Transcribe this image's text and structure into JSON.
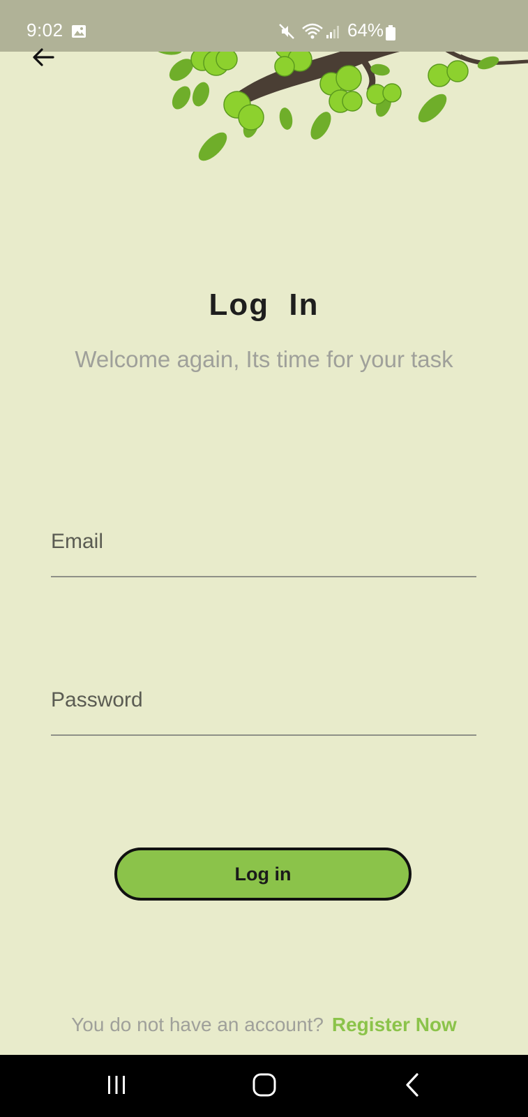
{
  "status_bar": {
    "time": "9:02",
    "battery": "64%",
    "icons": [
      "image-icon",
      "mute-icon",
      "wifi-icon",
      "signal-icon",
      "battery-icon"
    ]
  },
  "header": {
    "back_icon": "back-arrow-icon"
  },
  "main": {
    "title": "Log  In",
    "subtitle": "Welcome again, Its time for your task",
    "email_label": "Email",
    "password_label": "Password",
    "login_button_label": "Log in",
    "register_prompt": "You do not have an account?",
    "register_link": "Register Now"
  },
  "nav_bar": {
    "icons": [
      "recents-icon",
      "home-icon",
      "back-icon"
    ]
  },
  "colors": {
    "background": "#e8ebcb",
    "accent": "#8bc34a",
    "status_bar": "#b0b297",
    "muted_text": "#9fa09a",
    "title_text": "#1e1e1e"
  }
}
